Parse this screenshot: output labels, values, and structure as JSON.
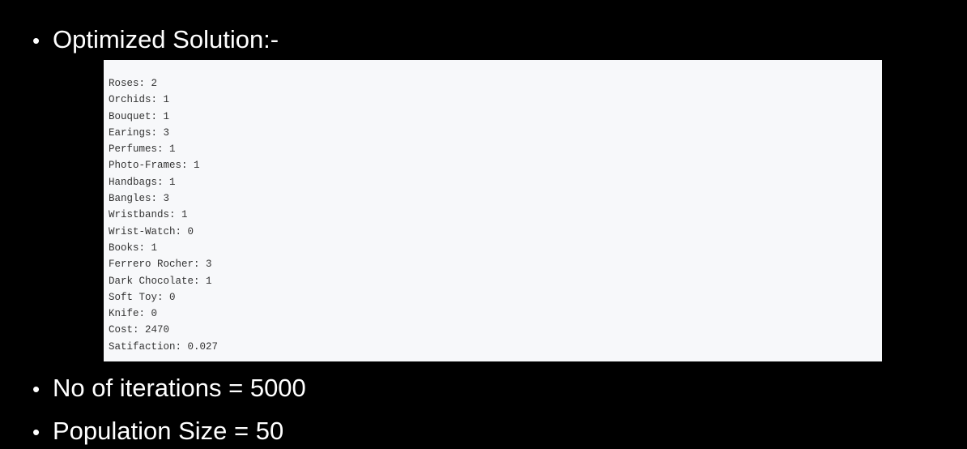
{
  "bullets": {
    "dot": "•",
    "first": "Optimized Solution:-",
    "second": "No of iterations = 5000",
    "third": "Population Size = 50"
  },
  "console": {
    "lines": [
      "Roses: 2",
      "Orchids: 1",
      "Bouquet: 1",
      "Earings: 3",
      "Perfumes: 1",
      "Photo-Frames: 1",
      "Handbags: 1",
      "Bangles: 3",
      "Wristbands: 1",
      "Wrist-Watch: 0",
      "Books: 1",
      "Ferrero Rocher: 3",
      "Dark Chocolate: 1",
      "Soft Toy: 0",
      "Knife: 0",
      "Cost: 2470",
      "Satifaction: 0.027"
    ]
  },
  "colors": {
    "background": "#000000",
    "text": "#ffffff",
    "console_background": "#f7f8fa",
    "console_text": "#333333"
  }
}
